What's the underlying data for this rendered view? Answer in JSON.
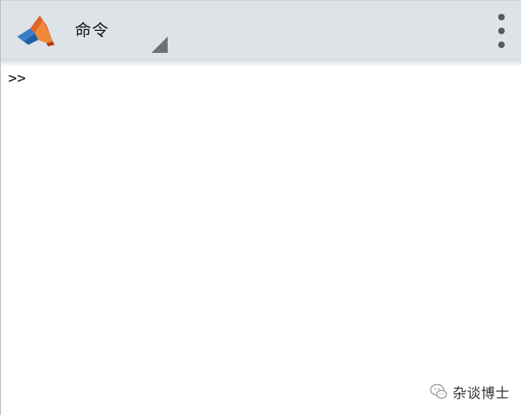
{
  "app": {
    "window_title": "命令"
  },
  "toolbar": {
    "logo_icon": "matlab-logo-icon",
    "title": "命令",
    "dropdown_icon": "dropdown-triangle-icon",
    "menu_icon": "overflow-menu-icon"
  },
  "console": {
    "prompt": ">>",
    "input_value": ""
  },
  "watermark": {
    "icon": "wechat-icon",
    "text": "杂谈博士"
  },
  "colors": {
    "toolbar_bg": "#dde3e7",
    "console_bg": "#ffffff",
    "logo_orange": "#e8742a",
    "logo_blue": "#4e8fd1"
  }
}
